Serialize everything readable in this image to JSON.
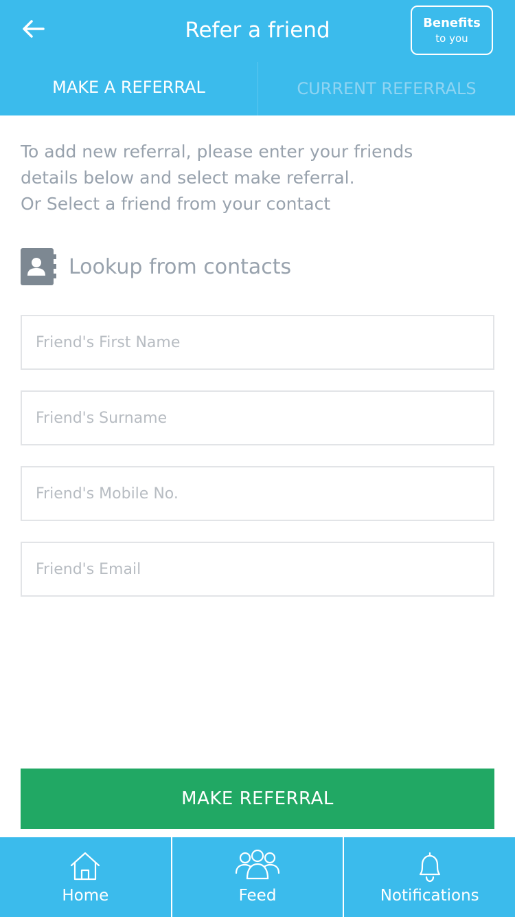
{
  "header": {
    "title": "Refer a friend",
    "back_icon": "arrow-left-icon",
    "benefits_line1": "Benefits",
    "benefits_line2": "to you"
  },
  "tabs": [
    {
      "label": "MAKE A REFERRAL",
      "active": true
    },
    {
      "label": "CURRENT REFERRALS",
      "active": false
    }
  ],
  "intro": {
    "line1": "To add new referral, please enter your friends",
    "line2": "details below and select make referral.",
    "line3": "Or Select a friend from your contact"
  },
  "lookup": {
    "label": "Lookup from contacts",
    "icon": "contacts-book-icon"
  },
  "form": {
    "first_name_placeholder": "Friend's First Name",
    "surname_placeholder": "Friend's Surname",
    "mobile_placeholder": "Friend's Mobile No.",
    "email_placeholder": "Friend's Email",
    "submit_label": "MAKE REFERRAL"
  },
  "bottom_nav": [
    {
      "label": "Home",
      "icon": "home-icon"
    },
    {
      "label": "Feed",
      "icon": "group-icon"
    },
    {
      "label": "Notifications",
      "icon": "bell-icon"
    }
  ],
  "colors": {
    "primary": "#3bbbec",
    "submit": "#21a864",
    "muted_text": "#98a2ad",
    "inactive_tab": "#8fd4f2"
  }
}
